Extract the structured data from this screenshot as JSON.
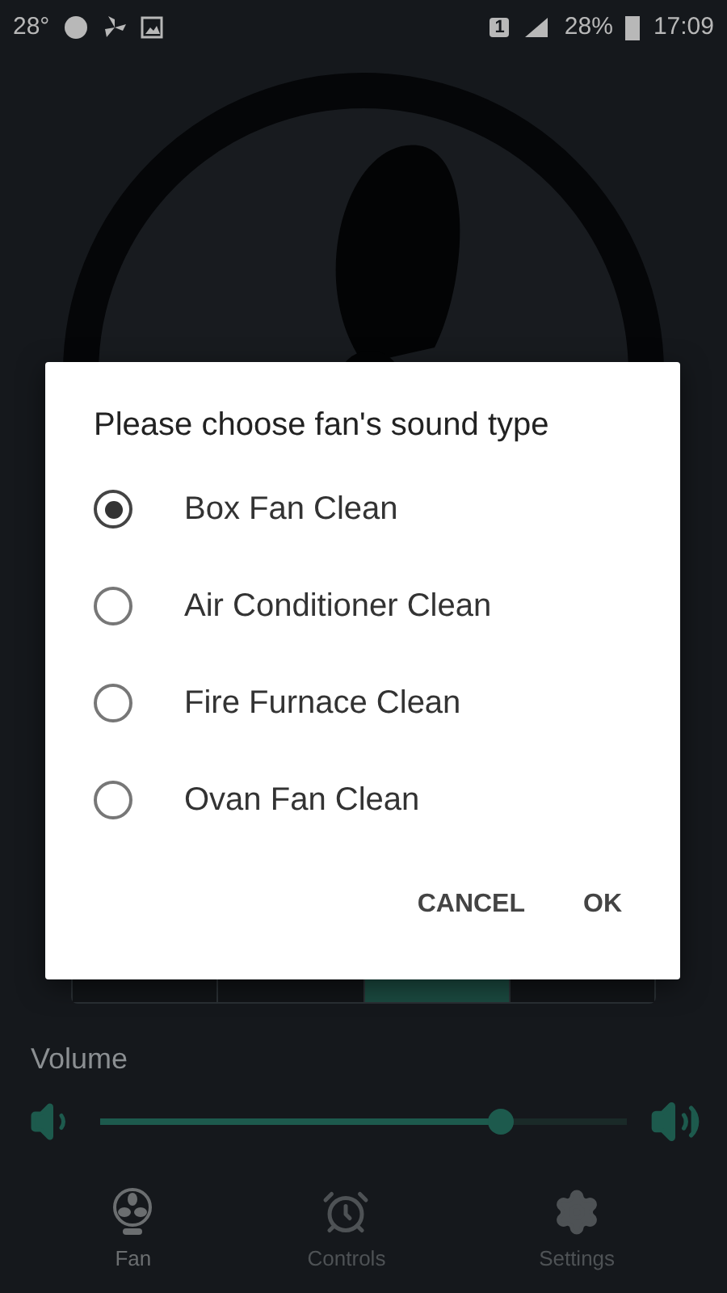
{
  "status_bar": {
    "temperature": "28°",
    "sim": "1",
    "battery": "28%",
    "time": "17:09"
  },
  "speed_selector": {
    "segments": [
      {
        "selected": false
      },
      {
        "selected": false
      },
      {
        "selected": true
      },
      {
        "selected": false
      }
    ]
  },
  "volume": {
    "label": "Volume",
    "level": 0.76
  },
  "bottom_nav": [
    {
      "label": "Fan",
      "selected": true
    },
    {
      "label": "Controls",
      "selected": false
    },
    {
      "label": "Settings",
      "selected": false
    }
  ],
  "dialog": {
    "title": "Please choose fan's sound type",
    "options": [
      {
        "label": "Box Fan Clean",
        "selected": true
      },
      {
        "label": "Air Conditioner Clean",
        "selected": false
      },
      {
        "label": "Fire Furnace Clean",
        "selected": false
      },
      {
        "label": "Ovan Fan Clean",
        "selected": false
      }
    ],
    "buttons": [
      "CANCEL",
      "OK"
    ]
  }
}
